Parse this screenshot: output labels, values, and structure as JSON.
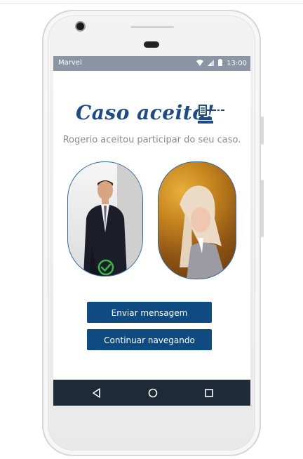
{
  "status_bar": {
    "carrier": "Marvel",
    "time": "13:00"
  },
  "content": {
    "title": "Caso aceito!",
    "subtitle": "Rogerio aceitou participar do seu caso."
  },
  "actions": {
    "send_message": "Enviar mensagem",
    "continue_browsing": "Continuar navegando"
  },
  "icons": {
    "title_icon": "gavel-icon",
    "accepted_badge": "check-circle-icon",
    "nav_back": "back-triangle-icon",
    "nav_home": "home-circle-icon",
    "nav_recents": "recents-square-icon"
  },
  "colors": {
    "primary": "#0f4b80",
    "title": "#1e4a86",
    "accepted": "#3bb54a",
    "status_bar": "#8b95a4",
    "nav_bar": "#1e2a38"
  }
}
